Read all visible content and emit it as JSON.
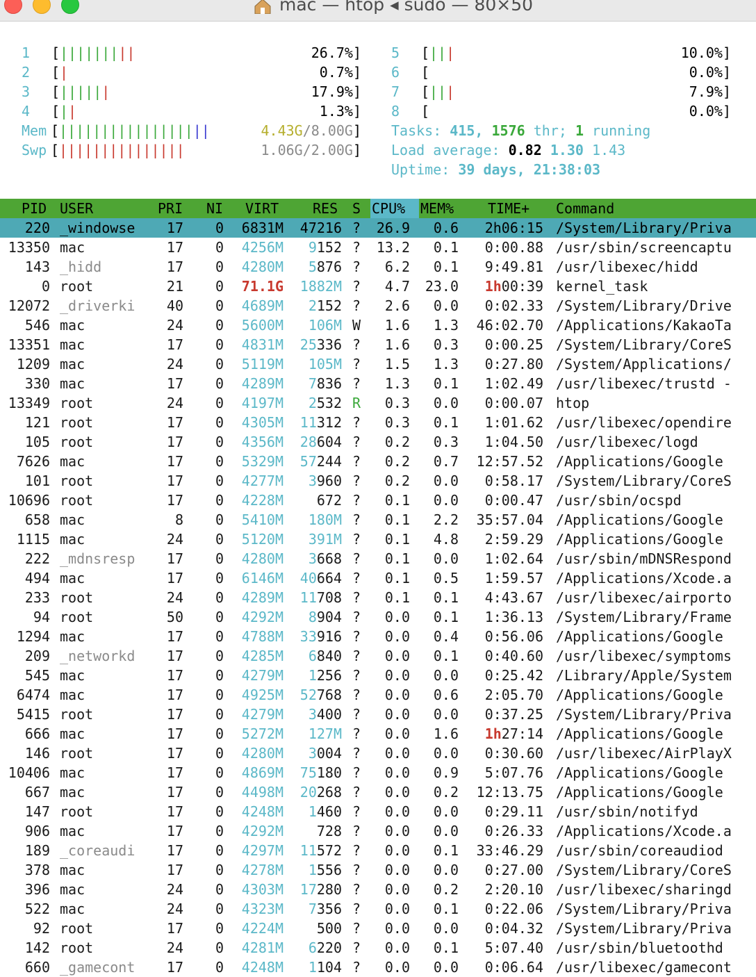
{
  "window": {
    "title": "mac — htop ◂ sudo — 80×50"
  },
  "cpu_meters": [
    {
      "id": "1",
      "bars": "|||||||||",
      "colors": "gggggggrr",
      "value": "26.7%]"
    },
    {
      "id": "2",
      "bars": "|",
      "colors": "r",
      "value": "0.7%]"
    },
    {
      "id": "3",
      "bars": "||||||",
      "colors": "gggggr",
      "value": "17.9%]"
    },
    {
      "id": "4",
      "bars": "||",
      "colors": "gr",
      "value": "1.3%]"
    },
    {
      "id": "5",
      "bars": "|||",
      "colors": "ggr",
      "value": "10.0%]"
    },
    {
      "id": "6",
      "bars": "",
      "colors": "",
      "value": "0.0%]"
    },
    {
      "id": "7",
      "bars": "|||",
      "colors": "ggr",
      "value": "7.9%]"
    },
    {
      "id": "8",
      "bars": "",
      "colors": "",
      "value": "0.0%]"
    }
  ],
  "mem": {
    "label": "Mem",
    "bars": "||||||||||||||||||",
    "value": "4.43G/8.00G]"
  },
  "swp": {
    "label": "Swp",
    "bars": "|||||||||||||||",
    "value": "1.06G/2.00G]"
  },
  "tasks": {
    "label": "Tasks:",
    "count": "415,",
    "threads": "1576",
    "thr": "thr;",
    "running_n": "1",
    "running": "running"
  },
  "load": {
    "label": "Load average:",
    "l1": "0.82",
    "l5": "1.30",
    "l15": "1.43"
  },
  "uptime": {
    "label": "Uptime:",
    "value": "39 days, 21:38:03"
  },
  "columns": {
    "pid": "PID",
    "user": "USER",
    "pri": "PRI",
    "ni": "NI",
    "virt": "VIRT",
    "res": "RES",
    "s": "S",
    "cpu": "CPU%",
    "mem": "MEM%",
    "time": "TIME+",
    "command": "Command"
  },
  "processes": [
    {
      "pid": "220",
      "user": "_windowse",
      "pri": "17",
      "ni": "0",
      "virt": "6831M",
      "res": "47216",
      "s": "?",
      "cpu": "26.9",
      "mem": "0.6",
      "time": "2h06:15",
      "cmd": "/System/Library/Priva"
    },
    {
      "pid": "13350",
      "user": "mac",
      "pri": "17",
      "ni": "0",
      "virt": "4256M",
      "res": "9152",
      "s": "?",
      "cpu": "13.2",
      "mem": "0.1",
      "time": "0:00.88",
      "cmd": "/usr/sbin/screencaptu"
    },
    {
      "pid": "143",
      "user": "_hidd",
      "pri": "17",
      "ni": "0",
      "virt": "4280M",
      "res": "5876",
      "s": "?",
      "cpu": "6.2",
      "mem": "0.1",
      "time": "9:49.81",
      "cmd": "/usr/libexec/hidd"
    },
    {
      "pid": "0",
      "user": "root",
      "pri": "21",
      "ni": "0",
      "virt": "71.1G",
      "res": "1882M",
      "s": "?",
      "cpu": "4.7",
      "mem": "23.0",
      "time": "1h00:39",
      "cmd": "kernel_task"
    },
    {
      "pid": "12072",
      "user": "_driverki",
      "pri": "40",
      "ni": "0",
      "virt": "4689M",
      "res": "2152",
      "s": "?",
      "cpu": "2.6",
      "mem": "0.0",
      "time": "0:02.33",
      "cmd": "/System/Library/Drive"
    },
    {
      "pid": "546",
      "user": "mac",
      "pri": "24",
      "ni": "0",
      "virt": "5600M",
      "res": "106M",
      "s": "W",
      "cpu": "1.6",
      "mem": "1.3",
      "time": "46:02.70",
      "cmd": "/Applications/KakaoTa"
    },
    {
      "pid": "13351",
      "user": "mac",
      "pri": "17",
      "ni": "0",
      "virt": "4831M",
      "res": "25336",
      "s": "?",
      "cpu": "1.6",
      "mem": "0.3",
      "time": "0:00.25",
      "cmd": "/System/Library/CoreS"
    },
    {
      "pid": "1209",
      "user": "mac",
      "pri": "24",
      "ni": "0",
      "virt": "5119M",
      "res": "105M",
      "s": "?",
      "cpu": "1.5",
      "mem": "1.3",
      "time": "0:27.80",
      "cmd": "/System/Applications/"
    },
    {
      "pid": "330",
      "user": "mac",
      "pri": "17",
      "ni": "0",
      "virt": "4289M",
      "res": "7836",
      "s": "?",
      "cpu": "1.3",
      "mem": "0.1",
      "time": "1:02.49",
      "cmd": "/usr/libexec/trustd -"
    },
    {
      "pid": "13349",
      "user": "root",
      "pri": "24",
      "ni": "0",
      "virt": "4197M",
      "res": "2532",
      "s": "R",
      "cpu": "0.3",
      "mem": "0.0",
      "time": "0:00.07",
      "cmd": "htop"
    },
    {
      "pid": "121",
      "user": "root",
      "pri": "17",
      "ni": "0",
      "virt": "4305M",
      "res": "11312",
      "s": "?",
      "cpu": "0.3",
      "mem": "0.1",
      "time": "1:01.62",
      "cmd": "/usr/libexec/opendire"
    },
    {
      "pid": "105",
      "user": "root",
      "pri": "17",
      "ni": "0",
      "virt": "4356M",
      "res": "28604",
      "s": "?",
      "cpu": "0.2",
      "mem": "0.3",
      "time": "1:04.50",
      "cmd": "/usr/libexec/logd"
    },
    {
      "pid": "7626",
      "user": "mac",
      "pri": "17",
      "ni": "0",
      "virt": "5329M",
      "res": "57244",
      "s": "?",
      "cpu": "0.2",
      "mem": "0.7",
      "time": "12:57.52",
      "cmd": "/Applications/Google "
    },
    {
      "pid": "101",
      "user": "root",
      "pri": "17",
      "ni": "0",
      "virt": "4277M",
      "res": "3960",
      "s": "?",
      "cpu": "0.2",
      "mem": "0.0",
      "time": "0:58.17",
      "cmd": "/System/Library/CoreS"
    },
    {
      "pid": "10696",
      "user": "root",
      "pri": "17",
      "ni": "0",
      "virt": "4228M",
      "res": "672",
      "s": "?",
      "cpu": "0.1",
      "mem": "0.0",
      "time": "0:00.47",
      "cmd": "/usr/sbin/ocspd"
    },
    {
      "pid": "658",
      "user": "mac",
      "pri": "8",
      "ni": "0",
      "virt": "5410M",
      "res": "180M",
      "s": "?",
      "cpu": "0.1",
      "mem": "2.2",
      "time": "35:57.04",
      "cmd": "/Applications/Google "
    },
    {
      "pid": "1115",
      "user": "mac",
      "pri": "24",
      "ni": "0",
      "virt": "5120M",
      "res": "391M",
      "s": "?",
      "cpu": "0.1",
      "mem": "4.8",
      "time": "2:59.29",
      "cmd": "/Applications/Google "
    },
    {
      "pid": "222",
      "user": "_mdnsresp",
      "pri": "17",
      "ni": "0",
      "virt": "4280M",
      "res": "3668",
      "s": "?",
      "cpu": "0.1",
      "mem": "0.0",
      "time": "1:02.64",
      "cmd": "/usr/sbin/mDNSRespond"
    },
    {
      "pid": "494",
      "user": "mac",
      "pri": "17",
      "ni": "0",
      "virt": "6146M",
      "res": "40664",
      "s": "?",
      "cpu": "0.1",
      "mem": "0.5",
      "time": "1:59.57",
      "cmd": "/Applications/Xcode.a"
    },
    {
      "pid": "233",
      "user": "root",
      "pri": "24",
      "ni": "0",
      "virt": "4289M",
      "res": "11708",
      "s": "?",
      "cpu": "0.1",
      "mem": "0.1",
      "time": "4:43.67",
      "cmd": "/usr/libexec/airporto"
    },
    {
      "pid": "94",
      "user": "root",
      "pri": "50",
      "ni": "0",
      "virt": "4292M",
      "res": "8904",
      "s": "?",
      "cpu": "0.0",
      "mem": "0.1",
      "time": "1:36.13",
      "cmd": "/System/Library/Frame"
    },
    {
      "pid": "1294",
      "user": "mac",
      "pri": "17",
      "ni": "0",
      "virt": "4788M",
      "res": "33916",
      "s": "?",
      "cpu": "0.0",
      "mem": "0.4",
      "time": "0:56.06",
      "cmd": "/Applications/Google "
    },
    {
      "pid": "209",
      "user": "_networkd",
      "pri": "17",
      "ni": "0",
      "virt": "4285M",
      "res": "6840",
      "s": "?",
      "cpu": "0.0",
      "mem": "0.1",
      "time": "0:40.60",
      "cmd": "/usr/libexec/symptoms"
    },
    {
      "pid": "545",
      "user": "mac",
      "pri": "17",
      "ni": "0",
      "virt": "4279M",
      "res": "1256",
      "s": "?",
      "cpu": "0.0",
      "mem": "0.0",
      "time": "0:25.42",
      "cmd": "/Library/Apple/System"
    },
    {
      "pid": "6474",
      "user": "mac",
      "pri": "17",
      "ni": "0",
      "virt": "4925M",
      "res": "52768",
      "s": "?",
      "cpu": "0.0",
      "mem": "0.6",
      "time": "2:05.70",
      "cmd": "/Applications/Google "
    },
    {
      "pid": "5415",
      "user": "root",
      "pri": "17",
      "ni": "0",
      "virt": "4279M",
      "res": "3400",
      "s": "?",
      "cpu": "0.0",
      "mem": "0.0",
      "time": "0:37.25",
      "cmd": "/System/Library/Priva"
    },
    {
      "pid": "666",
      "user": "mac",
      "pri": "17",
      "ni": "0",
      "virt": "5272M",
      "res": "127M",
      "s": "?",
      "cpu": "0.0",
      "mem": "1.6",
      "time": "1h27:14",
      "cmd": "/Applications/Google "
    },
    {
      "pid": "146",
      "user": "root",
      "pri": "17",
      "ni": "0",
      "virt": "4280M",
      "res": "3004",
      "s": "?",
      "cpu": "0.0",
      "mem": "0.0",
      "time": "0:30.60",
      "cmd": "/usr/libexec/AirPlayX"
    },
    {
      "pid": "10406",
      "user": "mac",
      "pri": "17",
      "ni": "0",
      "virt": "4869M",
      "res": "75180",
      "s": "?",
      "cpu": "0.0",
      "mem": "0.9",
      "time": "5:07.76",
      "cmd": "/Applications/Google "
    },
    {
      "pid": "667",
      "user": "mac",
      "pri": "17",
      "ni": "0",
      "virt": "4498M",
      "res": "20268",
      "s": "?",
      "cpu": "0.0",
      "mem": "0.2",
      "time": "12:13.75",
      "cmd": "/Applications/Google "
    },
    {
      "pid": "147",
      "user": "root",
      "pri": "17",
      "ni": "0",
      "virt": "4248M",
      "res": "1460",
      "s": "?",
      "cpu": "0.0",
      "mem": "0.0",
      "time": "0:29.11",
      "cmd": "/usr/sbin/notifyd"
    },
    {
      "pid": "906",
      "user": "mac",
      "pri": "17",
      "ni": "0",
      "virt": "4292M",
      "res": "728",
      "s": "?",
      "cpu": "0.0",
      "mem": "0.0",
      "time": "0:26.33",
      "cmd": "/Applications/Xcode.a"
    },
    {
      "pid": "189",
      "user": "_coreaudi",
      "pri": "17",
      "ni": "0",
      "virt": "4297M",
      "res": "11572",
      "s": "?",
      "cpu": "0.0",
      "mem": "0.1",
      "time": "33:46.29",
      "cmd": "/usr/sbin/coreaudiod"
    },
    {
      "pid": "378",
      "user": "mac",
      "pri": "17",
      "ni": "0",
      "virt": "4278M",
      "res": "1556",
      "s": "?",
      "cpu": "0.0",
      "mem": "0.0",
      "time": "0:27.00",
      "cmd": "/System/Library/CoreS"
    },
    {
      "pid": "396",
      "user": "mac",
      "pri": "24",
      "ni": "0",
      "virt": "4303M",
      "res": "17280",
      "s": "?",
      "cpu": "0.0",
      "mem": "0.2",
      "time": "2:20.10",
      "cmd": "/usr/libexec/sharingd"
    },
    {
      "pid": "522",
      "user": "mac",
      "pri": "24",
      "ni": "0",
      "virt": "4323M",
      "res": "7356",
      "s": "?",
      "cpu": "0.0",
      "mem": "0.1",
      "time": "0:22.06",
      "cmd": "/System/Library/Priva"
    },
    {
      "pid": "92",
      "user": "root",
      "pri": "17",
      "ni": "0",
      "virt": "4224M",
      "res": "500",
      "s": "?",
      "cpu": "0.0",
      "mem": "0.0",
      "time": "0:04.32",
      "cmd": "/System/Library/Priva"
    },
    {
      "pid": "142",
      "user": "root",
      "pri": "24",
      "ni": "0",
      "virt": "4281M",
      "res": "6220",
      "s": "?",
      "cpu": "0.0",
      "mem": "0.1",
      "time": "5:07.40",
      "cmd": "/usr/sbin/bluetoothd"
    },
    {
      "pid": "660",
      "user": "_gamecont",
      "pri": "17",
      "ni": "0",
      "virt": "4248M",
      "res": "1104",
      "s": "?",
      "cpu": "0.0",
      "mem": "0.0",
      "time": "0:06.64",
      "cmd": "/usr/libexec/gamecont"
    }
  ]
}
